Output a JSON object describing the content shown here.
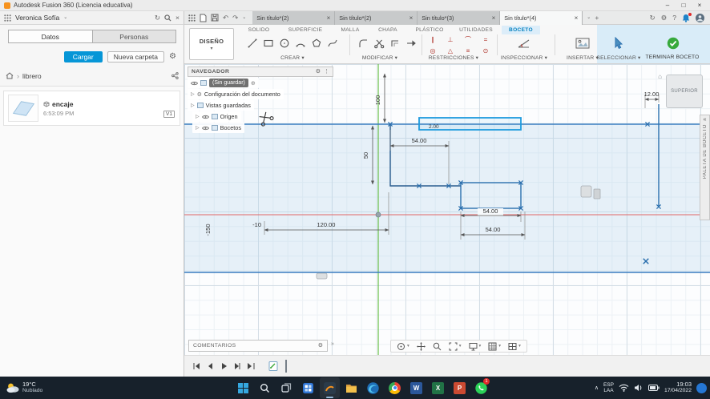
{
  "icons": {
    "minimize": "–",
    "maximize": "□",
    "close": "×",
    "caret_down": "▾",
    "chevron_down": "⌄",
    "chevron_up": "∧",
    "plus": "+",
    "plus_circle": "⊕",
    "undo": "↶",
    "redo": "↷",
    "gear": "⚙",
    "refresh": "↻",
    "breadcrumb_sep": "›",
    "collapse_left": "«",
    "more_right": "»",
    "tree_caret": "▷",
    "ellipsis_v": "⋮",
    "home": "⌂",
    "help": "?",
    "word": "W",
    "excel": "X",
    "powerpoint": "P"
  },
  "titlebar": {
    "title": "Autodesk Fusion 360 (Licencia educativa)"
  },
  "data_panel": {
    "user_name": "Veronica Sofía",
    "tabs": [
      {
        "label": "Datos"
      },
      {
        "label": "Personas"
      }
    ],
    "upload_label": "Cargar",
    "new_folder_label": "Nueva carpeta",
    "breadcrumb_root": "librero",
    "item": {
      "name": "encaje",
      "time": "6:53:09 PM",
      "version": "V1"
    }
  },
  "doc_tabs": [
    {
      "label": "Sin título*(2)"
    },
    {
      "label": "Sin título*(2)"
    },
    {
      "label": "Sin título*(3)"
    },
    {
      "label": "Sin título*(4)"
    }
  ],
  "ribbon": {
    "workspace_label": "DISEÑO",
    "env_tabs": [
      {
        "label": "SOLIDO"
      },
      {
        "label": "SUPERFICIE"
      },
      {
        "label": "MALLA"
      },
      {
        "label": "CHAPA"
      },
      {
        "label": "PLÁSTICO"
      },
      {
        "label": "UTILIDADES"
      },
      {
        "label": "BOCETO"
      }
    ],
    "groups": {
      "create": "CREAR",
      "modify": "MODIFICAR",
      "constraints": "RESTRICCIONES",
      "inspect": "INSPECCIONAR",
      "insert": "INSERTAR",
      "select": "SELECCIONAR",
      "finish": "TERMINAR BOCETO"
    },
    "constraint_glyphs": [
      "∥",
      "⊥",
      "⌒",
      "=",
      "◎",
      "△",
      "≡",
      "⊙"
    ]
  },
  "navigator": {
    "title": "NAVEGADOR",
    "root_label": "(Sin guardar)",
    "items": [
      {
        "label": "Configuración del documento"
      },
      {
        "label": "Vistas guardadas"
      },
      {
        "label": "Origen"
      },
      {
        "label": "Bocetos"
      }
    ]
  },
  "viewcube": {
    "face": "SUPERIOR"
  },
  "sketch_palette": {
    "label": "PALETA DE BOCETO"
  },
  "comments": {
    "label": "COMENTARIOS"
  },
  "sketch": {
    "dims": {
      "top_width": "54.00",
      "base_width": "120.00",
      "rect_width": "54.00",
      "rect_width_2": "54.00",
      "right_offset": "12.00",
      "slot_height": "2.00"
    },
    "refs": {
      "v100": "100",
      "v50": "50",
      "n10": "-10",
      "n150": "-150"
    }
  },
  "taskbar": {
    "weather": {
      "temp": "19°C",
      "condition": "Nublado"
    },
    "whatsapp_badge": "1",
    "tray": {
      "lang_top": "ESP",
      "lang_bottom": "LAA",
      "time": "19:03",
      "date": "17/04/2022"
    }
  },
  "colors": {
    "accent_blue": "#0696d7",
    "finish_green": "#37a93c",
    "axis_green": "#6abf4b",
    "axis_red": "#e06666",
    "sketch_blue": "#2a6fae",
    "selection_blue": "#1f9bde"
  }
}
